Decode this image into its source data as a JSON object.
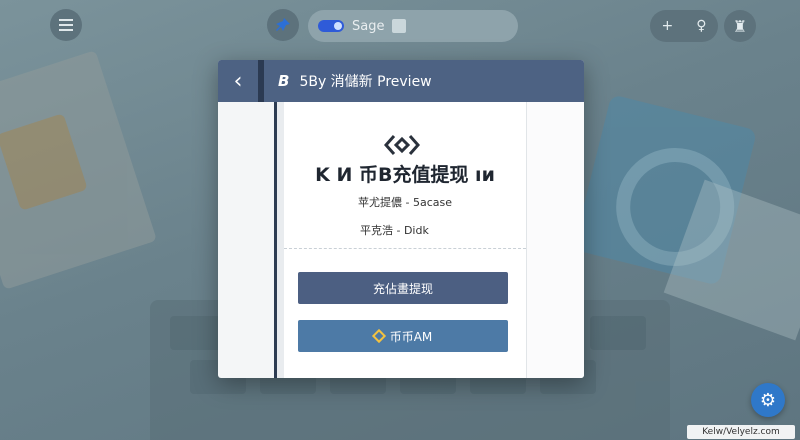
{
  "topbar": {
    "sage_label": "Sage",
    "right_icons": [
      "+",
      "♀"
    ],
    "gift_icon": "♜"
  },
  "dialog": {
    "header_logo": "B",
    "header_title": "5By 消儲新 Preview",
    "back_glyph": "‹",
    "brand_title": "K И 币B充值提现 ıи",
    "brand_sub": "苹尤提儂 - 5acase",
    "row_label": "平克浩 - Didk",
    "primary_button": "充佔畫提现",
    "secondary_button": "币币AM"
  },
  "fab_gear_glyph": "⚙",
  "watermark": "Kelw/Velyelz.com",
  "colors": {
    "header": "#4d6283",
    "primary": "#4c5f82",
    "secondary": "#4d7aa6",
    "fab": "#2f78c9"
  }
}
